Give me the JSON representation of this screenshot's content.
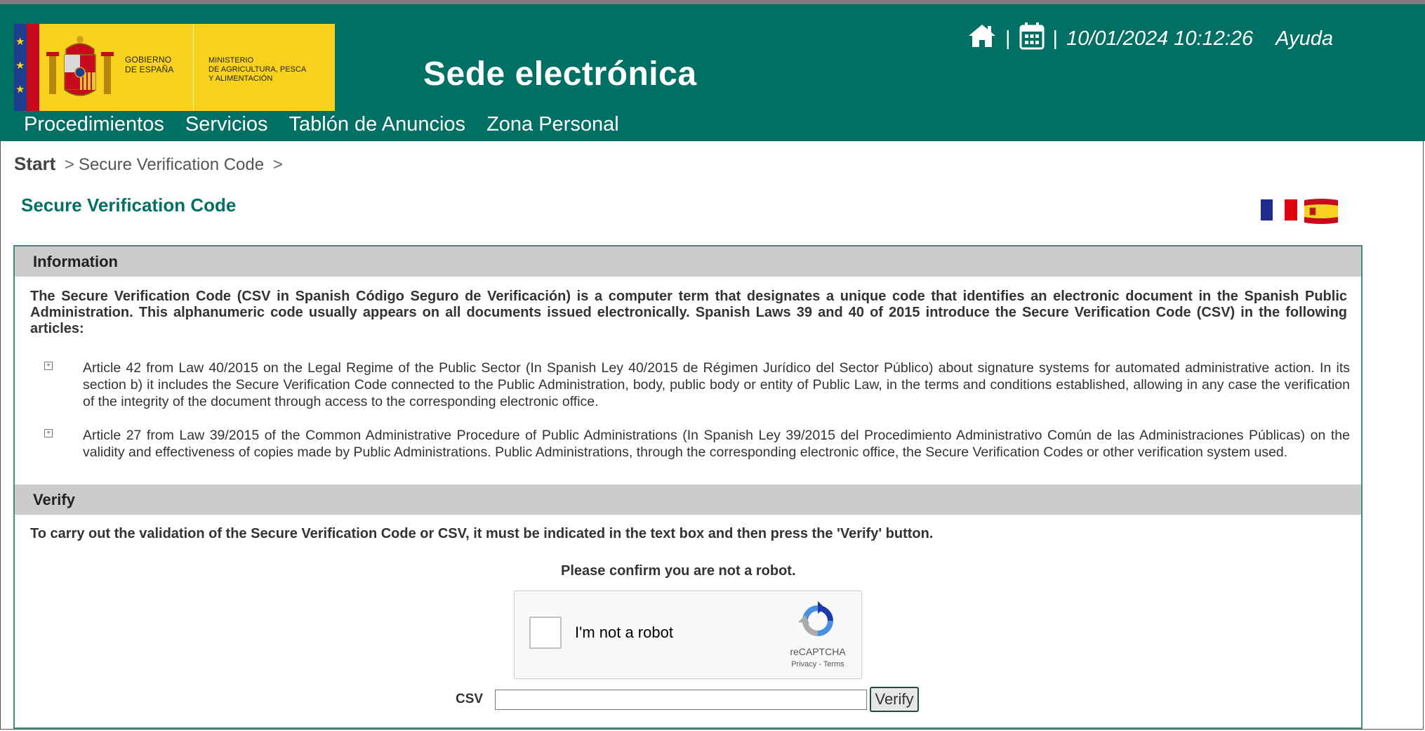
{
  "header": {
    "logo": {
      "gobierno_line1": "GOBIERNO",
      "gobierno_line2": "DE ESPAÑA",
      "ministerio_line1": "MINISTERIO",
      "ministerio_line2": "DE AGRICULTURA, PESCA",
      "ministerio_line3": "Y ALIMENTACIÓN"
    },
    "site_title": "Sede electrónica",
    "util": {
      "home_icon": "home-icon",
      "calendar_icon": "calendar-icon",
      "separator": "|",
      "datetime": "10/01/2024 10:12:26",
      "help": "Ayuda"
    },
    "nav": [
      {
        "label": "Procedimientos"
      },
      {
        "label": "Servicios"
      },
      {
        "label": "Tablón de Anuncios"
      },
      {
        "label": "Zona Personal"
      }
    ]
  },
  "breadcrumb": {
    "start": "Start",
    "separator": ">",
    "current": "Secure Verification Code"
  },
  "page": {
    "title": "Secure Verification Code",
    "flags": [
      "flag-france-icon",
      "flag-spain-icon"
    ]
  },
  "information": {
    "heading": "Information",
    "intro": "The Secure Verification Code (CSV in Spanish Código Seguro de Verificación) is a computer term that designates a unique code that identifies an electronic document in the Spanish Public Administration. This alphanumeric code usually appears on all documents issued electronically. Spanish Laws 39 and 40 of 2015 introduce the Secure Verification Code (CSV) in the following articles:",
    "articles": [
      {
        "text": "Article 42 from Law 40/2015 on the Legal Regime of the Public Sector (In Spanish Ley 40/2015 de Régimen Jurídico del Sector Público) about signature systems for automated administrative action. In its section b) it includes the Secure Verification Code connected to the Public Administration, body, public body or entity of Public Law, in the terms and conditions established, allowing in any case the verification of the integrity of the document through access to the corresponding electronic office."
      },
      {
        "text": "Article 27 from Law 39/2015 of the Common Administrative Procedure of Public Administrations (In Spanish Ley 39/2015 del Procedimiento Administrativo Común de las Administraciones Públicas) on the validity and effectiveness of copies made by Public Administrations. Public Administrations, through the corresponding electronic office, the Secure Verification Codes or other verification system used."
      }
    ]
  },
  "verify": {
    "heading": "Verify",
    "instructions": "To carry out the validation of the Secure Verification Code or CSV, it must be indicated in the text box and then press the 'Verify' button.",
    "robot_prompt": "Please confirm you are not a robot.",
    "recaptcha": {
      "label": "I'm not a robot",
      "brand": "reCAPTCHA",
      "links": "Privacy - Terms",
      "checked": false
    },
    "csv_label": "CSV",
    "csv_value": "",
    "button_label": "Verify"
  },
  "colors": {
    "header_bg": "#006f64",
    "logo_yellow": "#f8d21e",
    "title_green": "#006f64",
    "section_bar": "#cccccc"
  }
}
